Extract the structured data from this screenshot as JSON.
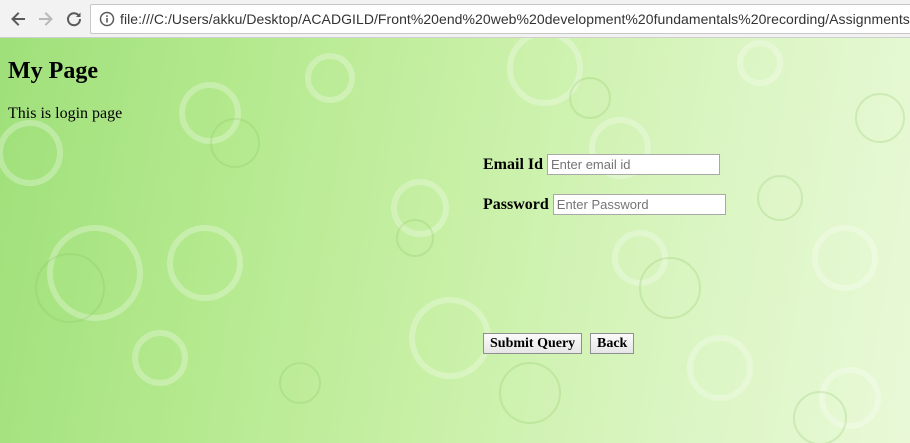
{
  "browser": {
    "url": "file:///C:/Users/akku/Desktop/ACADGILD/Front%20end%20web%20development%20fundamentals%20recording/Assignments%",
    "icons": [
      "back-arrow-icon",
      "forward-arrow-icon",
      "reload-icon",
      "info-icon"
    ]
  },
  "page": {
    "title": "My Page",
    "intro": "This is login page"
  },
  "form": {
    "email_label": "Email Id",
    "email_placeholder": "Enter email id",
    "email_value": "",
    "password_label": "Password",
    "password_placeholder": "Enter Password",
    "password_value": "",
    "submit_label": "Submit Query",
    "back_label": "Back"
  },
  "colors": {
    "background_start": "#9fe07a",
    "background_end": "#e9f9d8"
  }
}
